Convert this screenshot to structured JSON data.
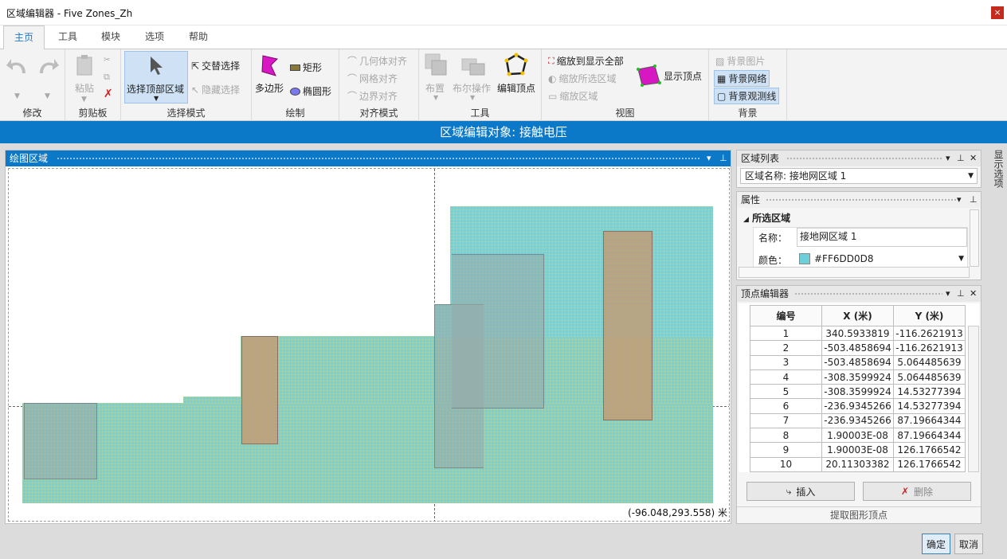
{
  "window": {
    "title": "区域编辑器 - Five Zones_Zh",
    "close": "×"
  },
  "tabs": [
    {
      "label": "主页"
    },
    {
      "label": "工具"
    },
    {
      "label": "模块"
    },
    {
      "label": "选项"
    },
    {
      "label": "帮助"
    }
  ],
  "ribbon": {
    "groups": {
      "modify": "修改",
      "clipboard": "剪贴板",
      "select_mode": "选择模式",
      "draw": "绘制",
      "align": "对齐模式",
      "tools": "工具",
      "view": "视图",
      "background": "背景"
    },
    "paste": "粘贴",
    "select_top": "选择顶部区域",
    "cross_select": "交替选择",
    "hide_select": "隐藏选择",
    "polygon": "多边形",
    "rect": "矩形",
    "ellipse": "椭圆形",
    "geom_align": "几何体对齐",
    "grid_align": "网格对齐",
    "edge_align": "边界对齐",
    "layout": "布置",
    "boolean": "布尔操作",
    "edit_vertex": "编辑顶点",
    "zoom_all": "缩放到显示全部",
    "zoom_sel": "缩放所选区域",
    "zoom_area": "缩放区域",
    "show_vertex": "显示顶点",
    "bg_image": "背景图片",
    "bg_grid": "背景网络",
    "bg_lines": "背景观测线"
  },
  "banner": "区域编辑对象: 接触电压",
  "draw_panel": {
    "title": "绘图区域",
    "coord": "(-96.048,293.558) 米"
  },
  "zone_list": {
    "title": "区域列表",
    "selected": "区域名称: 接地网区域 1"
  },
  "properties": {
    "title": "属性",
    "section": "所选区域",
    "name_label": "名称：",
    "name_value": "接地网区域 1",
    "color_label": "颜色：",
    "color_value": "#FF6DD0D8",
    "swatch": "#6dd0d8"
  },
  "vertex_editor": {
    "title": "顶点编辑器",
    "headers": [
      "编号",
      "X (米)",
      "Y (米)"
    ],
    "rows": [
      [
        "1",
        "340.5933819",
        "-116.2621913"
      ],
      [
        "2",
        "-503.4858694",
        "-116.2621913"
      ],
      [
        "3",
        "-503.4858694",
        "5.064485639"
      ],
      [
        "4",
        "-308.3599924",
        "5.064485639"
      ],
      [
        "5",
        "-308.3599924",
        "14.53277394"
      ],
      [
        "6",
        "-236.9345266",
        "14.53277394"
      ],
      [
        "7",
        "-236.9345266",
        "87.19664344"
      ],
      [
        "8",
        "1.90003E-08",
        "87.19664344"
      ],
      [
        "9",
        "1.90003E-08",
        "126.1766542"
      ],
      [
        "10",
        "20.11303382",
        "126.1766542"
      ]
    ],
    "insert": "插入",
    "delete": "删除",
    "extract": "提取图形顶点"
  },
  "side_tab": "显示选项",
  "footer": {
    "ok": "确定",
    "cancel": "取消"
  }
}
